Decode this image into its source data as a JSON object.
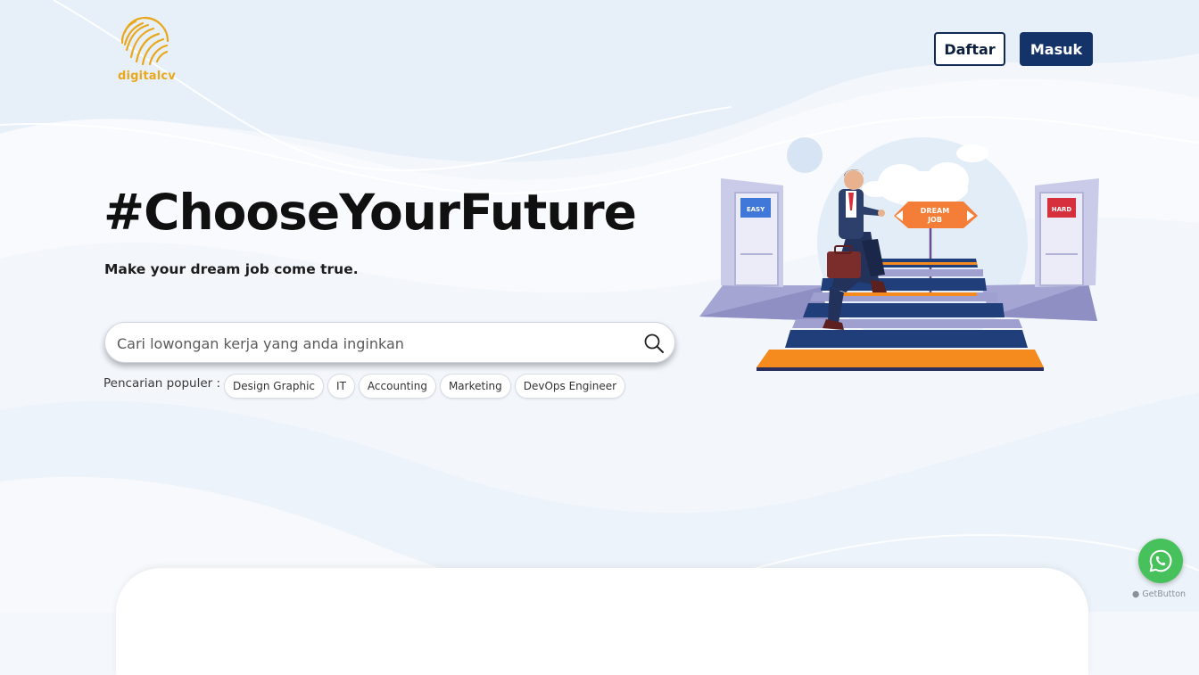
{
  "brand": {
    "name": "digitalcv",
    "logo_icon": "fingerprint-circle-icon",
    "accent": "#e9a81c"
  },
  "nav": {
    "register_label": "Daftar",
    "login_label": "Masuk",
    "primary_color": "#143469"
  },
  "hero": {
    "headline": "#ChooseYourFuture",
    "subheadline": "Make your dream job come true.",
    "illustration": {
      "left_door_sign": "EASY",
      "right_door_sign": "HARD",
      "signpost_line1": "DREAM",
      "signpost_line2": "JOB"
    }
  },
  "search": {
    "placeholder": "Cari lowongan kerja yang anda inginkan",
    "value": "",
    "icon": "search-icon"
  },
  "popular": {
    "label": "Pencarian populer :",
    "items": [
      {
        "label": "Design Graphic"
      },
      {
        "label": "IT"
      },
      {
        "label": "Accounting"
      },
      {
        "label": "Marketing"
      },
      {
        "label": "DevOps Engineer"
      }
    ]
  },
  "whatsapp": {
    "icon": "whatsapp-icon",
    "color": "#47c15b",
    "credit": "GetButton"
  }
}
